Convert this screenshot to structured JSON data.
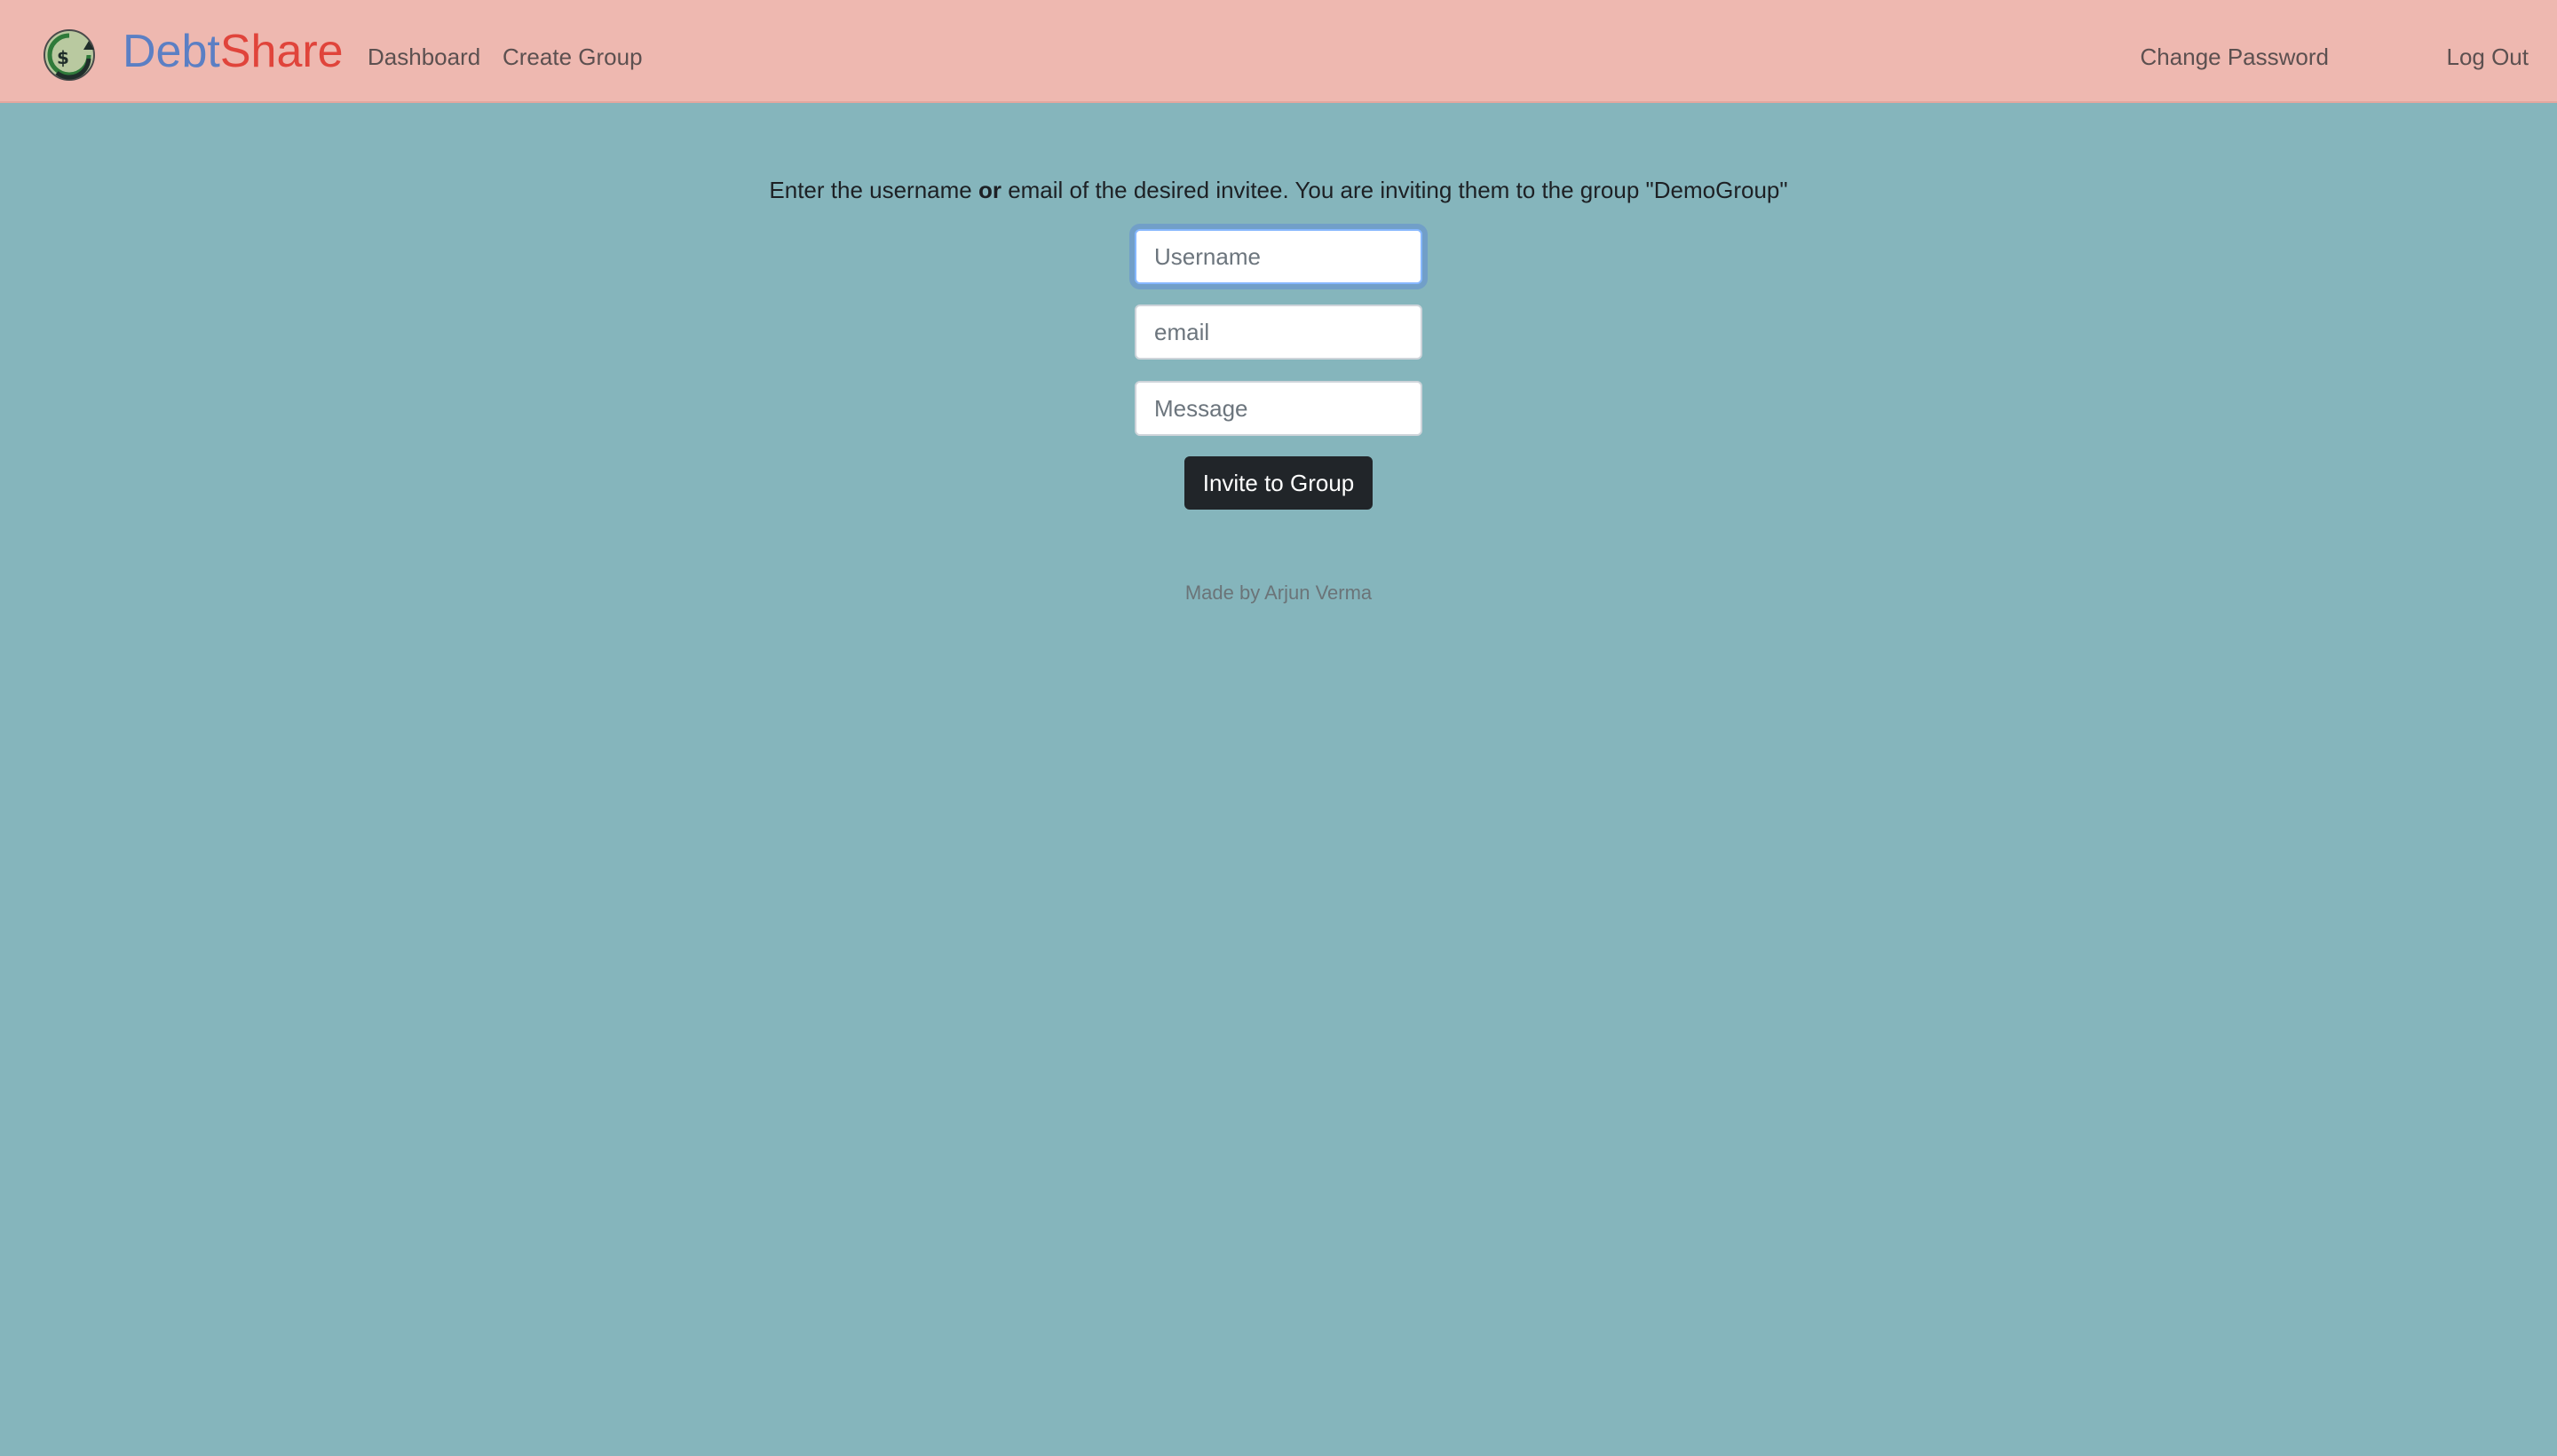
{
  "app": {
    "brand_part1": "Debt",
    "brand_part2": "Share",
    "logo_icon": "dollar-refresh-icon"
  },
  "nav": {
    "dashboard": "Dashboard",
    "create_group": "Create Group",
    "change_password": "Change Password",
    "log_out": "Log Out"
  },
  "form": {
    "instruction_before": "Enter the username ",
    "instruction_bold": "or",
    "instruction_after": " email of the desired invitee. You are inviting them to the group \"DemoGroup\"",
    "username_placeholder": "Username",
    "username_value": "",
    "email_placeholder": "email",
    "email_value": "",
    "message_placeholder": "Message",
    "message_value": "",
    "submit_label": "Invite to Group"
  },
  "footer": {
    "text": "Made by Arjun Verma"
  },
  "colors": {
    "navbar_bg": "#eeb8b0",
    "page_bg": "#85b5bc",
    "brand_debt": "#5b7fc4",
    "brand_share": "#e0443b",
    "button_bg": "#212529"
  }
}
